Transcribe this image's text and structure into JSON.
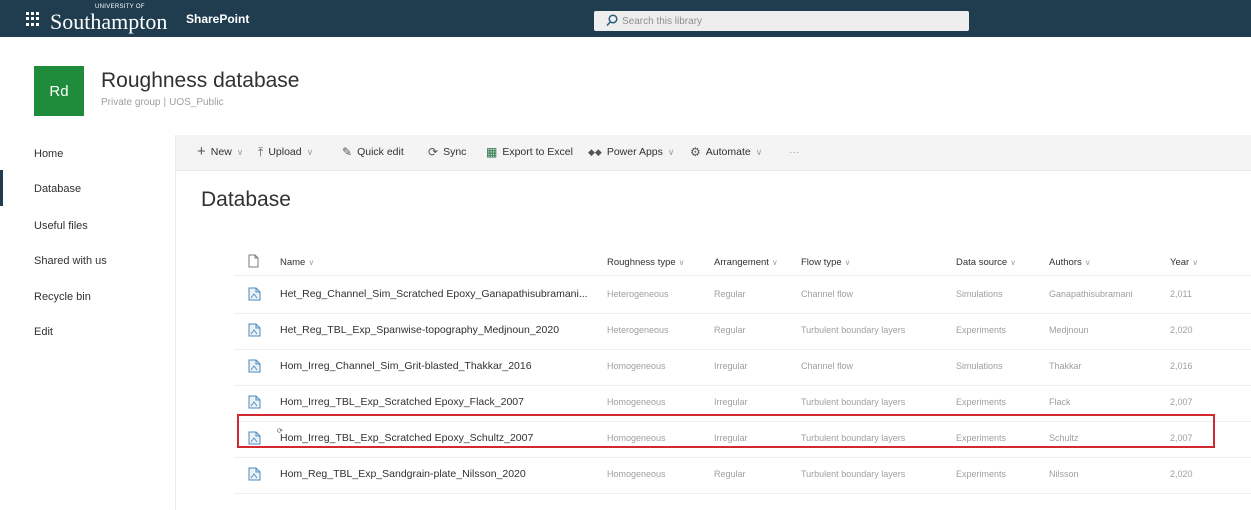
{
  "suite_bar": {
    "brand_top": "UNIVERSITY OF",
    "brand": "Southampton",
    "app_name": "SharePoint",
    "search_placeholder": "Search this library"
  },
  "site": {
    "logo_initials": "Rd",
    "title": "Roughness database",
    "privacy": "Private group",
    "classification": "UOS_Public"
  },
  "nav": {
    "items": [
      {
        "label": "Home",
        "active": false
      },
      {
        "label": "Database",
        "active": true
      },
      {
        "label": "Useful files",
        "active": false
      },
      {
        "label": "Shared with us",
        "active": false
      },
      {
        "label": "Recycle bin",
        "active": false
      },
      {
        "label": "Edit",
        "active": false
      }
    ]
  },
  "command_bar": {
    "new": "New",
    "upload": "Upload",
    "quick_edit": "Quick edit",
    "sync": "Sync",
    "export": "Export to Excel",
    "power_apps": "Power Apps",
    "automate": "Automate",
    "more": "···"
  },
  "page": {
    "heading": "Database"
  },
  "table": {
    "columns": [
      "Name",
      "Roughness type",
      "Arrangement",
      "Flow type",
      "Data source",
      "Authors",
      "Year"
    ],
    "rows": [
      [
        "Het_Reg_Channel_Sim_Scratched Epoxy_Ganapathisubramani...",
        "Heterogeneous",
        "Regular",
        "Channel flow",
        "Simulations",
        "Ganapathisubramani",
        "2,011"
      ],
      [
        "Het_Reg_TBL_Exp_Spanwise-topography_Medjnoun_2020",
        "Heterogeneous",
        "Regular",
        "Turbulent boundary layers",
        "Experiments",
        "Medjnoun",
        "2,020"
      ],
      [
        "Hom_Irreg_Channel_Sim_Grit-blasted_Thakkar_2016",
        "Homogeneous",
        "Irregular",
        "Channel flow",
        "Simulations",
        "Thakkar",
        "2,016"
      ],
      [
        "Hom_Irreg_TBL_Exp_Scratched Epoxy_Flack_2007",
        "Homogeneous",
        "Irregular",
        "Turbulent boundary layers",
        "Experiments",
        "Flack",
        "2,007"
      ],
      [
        "Hom_Irreg_TBL_Exp_Scratched Epoxy_Schultz_2007",
        "Homogeneous",
        "Irregular",
        "Turbulent boundary layers",
        "Experiments",
        "Schultz",
        "2,007"
      ],
      [
        "Hom_Reg_TBL_Exp_Sandgrain-plate_Nilsson_2020",
        "Homogeneous",
        "Regular",
        "Turbulent boundary layers",
        "Experiments",
        "Nilsson",
        "2,020"
      ]
    ],
    "highlighted_row": 4
  },
  "colors": {
    "suite_bar": "#1f3d4f",
    "site_logo": "#1e8c3a",
    "highlight": "#d1292f"
  }
}
